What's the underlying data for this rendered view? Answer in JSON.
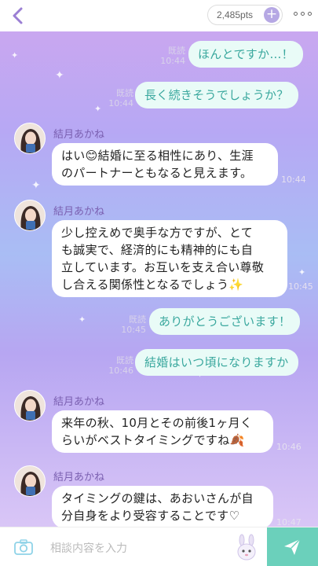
{
  "header": {
    "points": "2,485pts",
    "plus_icon": "+"
  },
  "messages": {
    "out": [
      {
        "text": "ほんとですか…！",
        "status": "既読",
        "time": "10:44"
      },
      {
        "text": "長く続きそうでしょうか？",
        "status": "既読",
        "time": "10:44"
      },
      {
        "text": "ありがとうございます！",
        "status": "既読",
        "time": "10:45"
      },
      {
        "text": "結婚はいつ頃になりますか",
        "status": "既読",
        "time": "10:46"
      }
    ],
    "in": [
      {
        "name": "結月あかね",
        "text": "はい😊結婚に至る相性にあり、生涯\nのパートナーともなると見えます。",
        "time": "10:44"
      },
      {
        "name": "結月あかね",
        "text": "少し控えめで奥手な方ですが、とて\nも誠実で、経済的にも精神的にも自\n立しています。お互いを支え合い尊敬\nし合える関係性となるでしょう✨",
        "time": "10:45"
      },
      {
        "name": "結月あかね",
        "text": "来年の秋、10月とその前後1ヶ月く\nらいがベストタイミングですね🍂",
        "time": "10:46"
      },
      {
        "name": "結月あかね",
        "text": "タイミングの鍵は、あおいさんが自\n分自身をより受容することです♡",
        "time": "10:47"
      }
    ]
  },
  "footer": {
    "placeholder": "相談内容を入力"
  },
  "colors": {
    "accent_send": "#6bd0bb",
    "outgoing_text": "#3aa89e",
    "name_text": "#7a5fb0"
  },
  "icons": [
    "back-chevron-icon",
    "plus-icon",
    "more-dots-icon",
    "camera-icon",
    "mascot-icon",
    "send-icon"
  ]
}
